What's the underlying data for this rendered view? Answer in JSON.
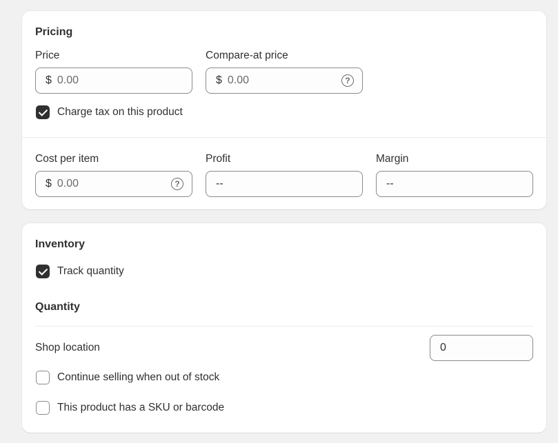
{
  "pricing": {
    "title": "Pricing",
    "price": {
      "label": "Price",
      "prefix": "$",
      "placeholder": "0.00"
    },
    "compare_at": {
      "label": "Compare-at price",
      "prefix": "$",
      "placeholder": "0.00",
      "help_icon": "question-circle-icon"
    },
    "charge_tax": {
      "label": "Charge tax on this product",
      "checked": true
    },
    "cost_per_item": {
      "label": "Cost per item",
      "prefix": "$",
      "placeholder": "0.00",
      "help_icon": "question-circle-icon"
    },
    "profit": {
      "label": "Profit",
      "value": "--"
    },
    "margin": {
      "label": "Margin",
      "value": "--"
    }
  },
  "inventory": {
    "title": "Inventory",
    "track_quantity": {
      "label": "Track quantity",
      "checked": true
    },
    "quantity_title": "Quantity",
    "shop_location": {
      "label": "Shop location",
      "value": "0"
    },
    "continue_selling": {
      "label": "Continue selling when out of stock",
      "checked": false
    },
    "has_sku": {
      "label": "This product has a SKU or barcode",
      "checked": false
    }
  },
  "colors": {
    "checked": "#303030",
    "border": "#8a8a8a",
    "background": "#f1f1f1"
  }
}
